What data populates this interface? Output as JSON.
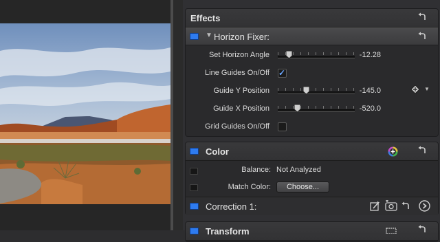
{
  "effects": {
    "title": "Effects",
    "horizon_fixer": {
      "title": "Horizon Fixer:",
      "params": [
        {
          "label": "Set Horizon Angle",
          "value": "-12.28",
          "position": 0.14
        },
        {
          "label": "Guide Y Position",
          "value": "-145.0",
          "position": 0.36
        },
        {
          "label": "Guide X Position",
          "value": "-520.0",
          "position": 0.25
        }
      ],
      "line_guides": {
        "label": "Line Guides On/Off",
        "checked": true
      },
      "grid_guides": {
        "label": "Grid Guides On/Off",
        "checked": false
      }
    }
  },
  "color": {
    "title": "Color",
    "balance": {
      "label": "Balance:",
      "value": "Not Analyzed"
    },
    "match_color": {
      "label": "Match Color:",
      "button": "Choose..."
    },
    "correction": {
      "title": "Correction 1:"
    }
  },
  "transform": {
    "title": "Transform"
  },
  "colors": {
    "accent_blue": "#2e7bf0",
    "check_blue": "#6aa6ff"
  }
}
